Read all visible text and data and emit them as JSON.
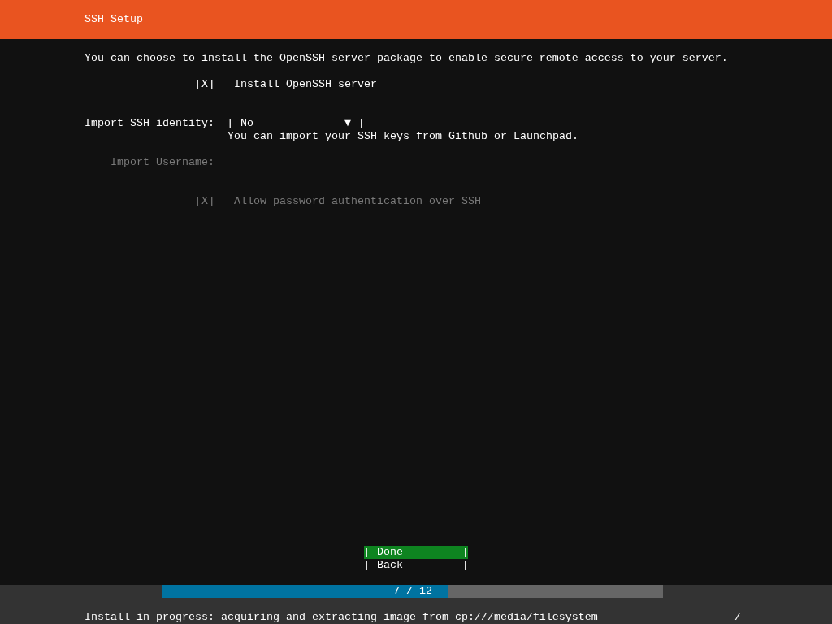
{
  "header": {
    "title": "SSH Setup"
  },
  "intro": "You can choose to install the OpenSSH server package to enable secure remote access to your server.",
  "install_openssh": {
    "box": [
      "[",
      "X",
      "]"
    ],
    "checked": true,
    "disabled": false,
    "label": "Install OpenSSH server"
  },
  "import_identity": {
    "label": "Import SSH identity:",
    "value": "[ No              ▼ ]",
    "hint": "You can import your SSH keys from Github or Launchpad.",
    "disabled": false
  },
  "import_username": {
    "label": "Import Username:",
    "disabled": true
  },
  "allow_password": {
    "box": [
      "[",
      "X",
      "]"
    ],
    "checked": true,
    "disabled": true,
    "label": "Allow password authentication over SSH"
  },
  "buttons": [
    {
      "label": "[ Done         ]",
      "selected": true
    },
    {
      "label": "[ Back         ]",
      "selected": false
    }
  ],
  "progress": {
    "level": 0.57,
    "text": "7 / 12"
  },
  "status": {
    "text": "Install in progress: acquiring and extracting image from cp:///media/filesystem",
    "spinner": "/"
  }
}
